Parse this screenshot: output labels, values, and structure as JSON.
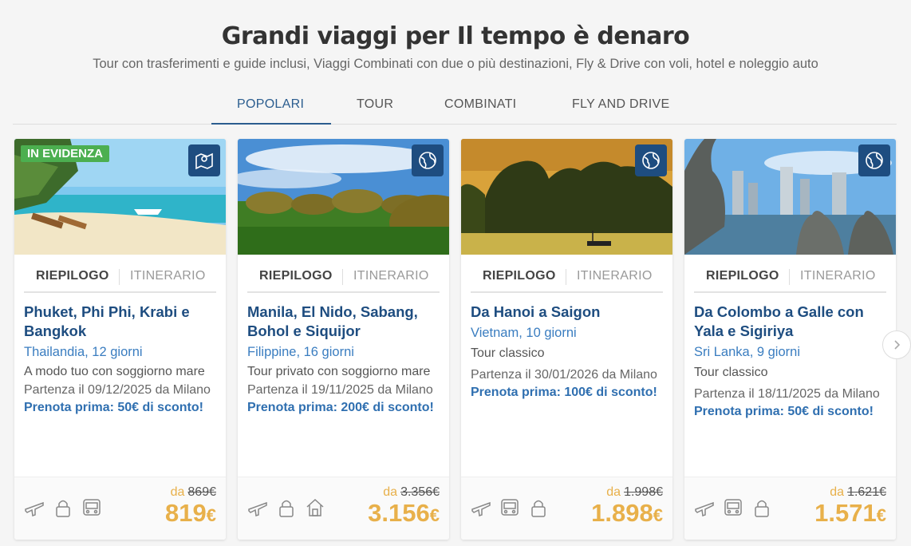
{
  "header": {
    "title": "Grandi viaggi per Il tempo è denaro",
    "subtitle": "Tour con trasferimenti e guide inclusi, Viaggi Combinati con due o più destinazioni, Fly & Drive con voli, hotel e noleggio auto"
  },
  "tabs": [
    "POPOLARI",
    "TOUR",
    "COMBINATI",
    "FLY AND DRIVE"
  ],
  "cards": [
    {
      "badge": "IN EVIDENZA",
      "type_icon": "map-pin-icon",
      "tab_a": "RIEPILOGO",
      "tab_b": "ITINERARIO",
      "destination": "Phuket, Phi Phi, Krabi e Bangkok",
      "country": "Thailandia, 12 giorni",
      "description": "A modo tuo con soggiorno mare",
      "departure": "Partenza il 09/12/2025 da Milano",
      "promo": "Prenota prima: 50€ di sconto!",
      "price_from": "da",
      "price_old": "869€",
      "price_value": "819",
      "price_currency": "€",
      "icons": [
        "plane-icon",
        "lock-icon",
        "bus-icon"
      ]
    },
    {
      "badge": "",
      "type_icon": "globe-icon",
      "tab_a": "RIEPILOGO",
      "tab_b": "ITINERARIO",
      "destination": "Manila, El Nido, Sabang, Bohol e Siquijor",
      "country": "Filippine, 16 giorni",
      "description": "Tour privato con soggiorno mare",
      "departure": "Partenza il 19/11/2025 da Milano",
      "promo": "Prenota prima: 200€ di sconto!",
      "price_from": "da",
      "price_old": "3.356€",
      "price_value": "3.156",
      "price_currency": "€",
      "icons": [
        "plane-icon",
        "lock-icon",
        "house-icon"
      ]
    },
    {
      "badge": "",
      "type_icon": "globe-icon",
      "tab_a": "RIEPILOGO",
      "tab_b": "ITINERARIO",
      "destination": "Da Hanoi a Saigon",
      "country": "Vietnam, 10 giorni",
      "description": "Tour classico",
      "departure": "Partenza il 30/01/2026 da Milano",
      "promo": "Prenota prima: 100€ di sconto!",
      "price_from": "da",
      "price_old": "1.998€",
      "price_value": "1.898",
      "price_currency": "€",
      "icons": [
        "plane-icon",
        "bus-icon",
        "lock-icon"
      ]
    },
    {
      "badge": "",
      "type_icon": "globe-icon",
      "tab_a": "RIEPILOGO",
      "tab_b": "ITINERARIO",
      "destination": "Da Colombo a Galle con Yala e Sigiriya",
      "country": "Sri Lanka, 9 giorni",
      "description": "Tour classico",
      "departure": "Partenza il 18/11/2025 da Milano",
      "promo": "Prenota prima: 50€ di sconto!",
      "price_from": "da",
      "price_old": "1.621€",
      "price_value": "1.571",
      "price_currency": "€",
      "icons": [
        "plane-icon",
        "bus-icon",
        "lock-icon"
      ]
    }
  ],
  "colors": {
    "accent": "#1e4d80",
    "link": "#3a7dc0",
    "price": "#e8b04a",
    "badge": "#4caf50"
  }
}
